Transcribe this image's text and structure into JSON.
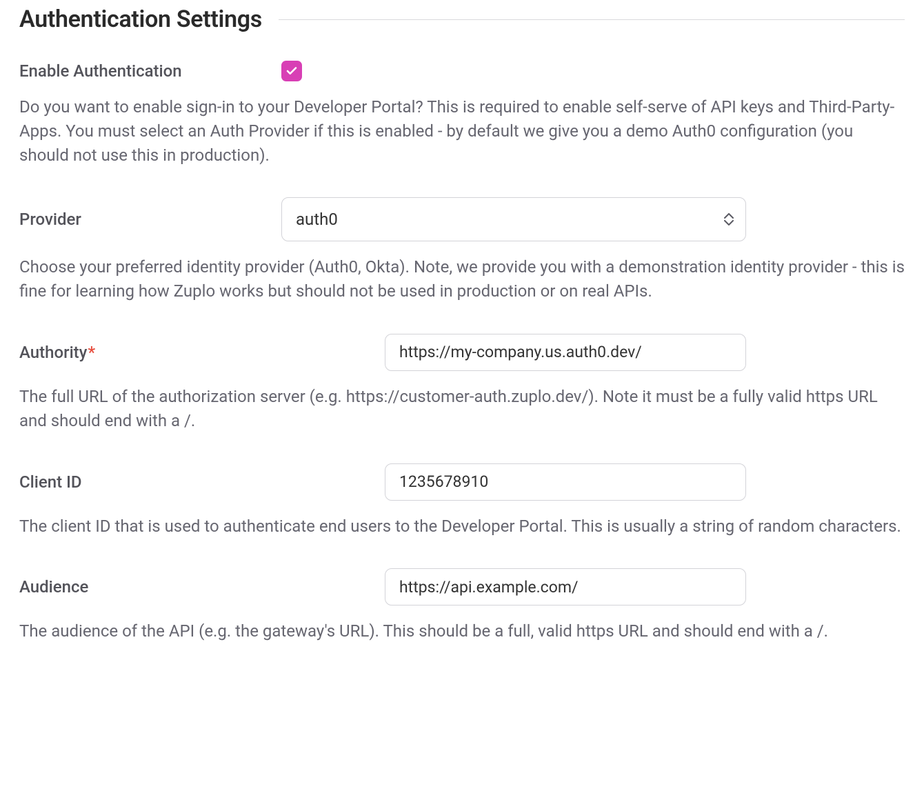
{
  "section": {
    "title": "Authentication Settings"
  },
  "fields": {
    "enable_auth": {
      "label": "Enable Authentication",
      "checked": true,
      "help": "Do you want to enable sign-in to your Developer Portal? This is required to enable self-serve of API keys and Third-Party-Apps. You must select an Auth Provider if this is enabled - by default we give you a demo Auth0 configuration (you should not use this in production)."
    },
    "provider": {
      "label": "Provider",
      "value": "auth0",
      "help": "Choose your preferred identity provider (Auth0, Okta). Note, we provide you with a demonstration identity provider - this is fine for learning how Zuplo works but should not be used in production or on real APIs."
    },
    "authority": {
      "label": "Authority",
      "required_marker": "*",
      "value": "https://my-company.us.auth0.dev/",
      "help": "The full URL of the authorization server (e.g. https://customer-auth.zuplo.dev/). Note it must be a fully valid https URL and should end with a /."
    },
    "client_id": {
      "label": "Client ID",
      "value": "1235678910",
      "help": "The client ID that is used to authenticate end users to the Developer Portal. This is usually a string of random characters."
    },
    "audience": {
      "label": "Audience",
      "value": "https://api.example.com/",
      "help": "The audience of the API (e.g. the gateway's URL). This should be a full, valid https URL and should end with a /."
    }
  }
}
